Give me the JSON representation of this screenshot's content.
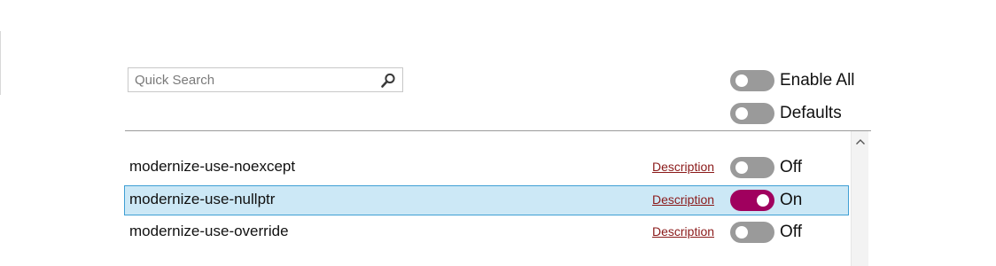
{
  "search": {
    "placeholder": "Quick Search",
    "icon": "search-icon"
  },
  "global_toggles": {
    "enable_all": {
      "label": "Enable All",
      "on": false
    },
    "defaults": {
      "label": "Defaults",
      "on": false
    }
  },
  "rules": [
    {
      "name": "modernize-use-noexcept",
      "link": "Description",
      "state_label": "Off",
      "on": false,
      "selected": false
    },
    {
      "name": "modernize-use-nullptr",
      "link": "Description",
      "state_label": "On",
      "on": true,
      "selected": true
    },
    {
      "name": "modernize-use-override",
      "link": "Description",
      "state_label": "Off",
      "on": false,
      "selected": false
    }
  ],
  "colors": {
    "accent_on": "#a0005e",
    "toggle_off": "#9a9a9a",
    "selection_bg": "#cce8f6",
    "selection_border": "#3f9fd4",
    "link": "#8b1a1a"
  }
}
